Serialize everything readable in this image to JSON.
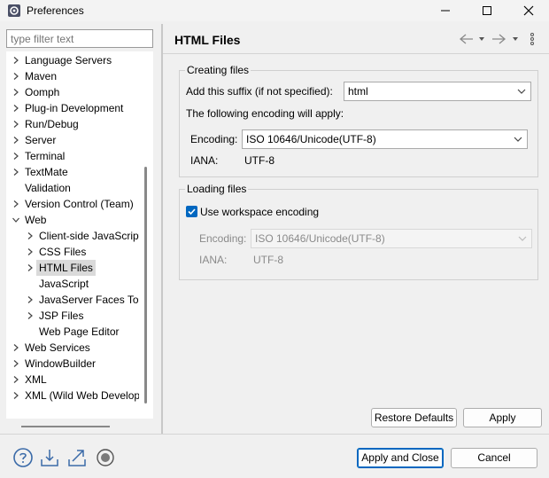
{
  "window": {
    "title": "Preferences"
  },
  "filter": {
    "placeholder": "type filter text"
  },
  "tree": {
    "items": [
      {
        "label": "Language Servers",
        "level": 0,
        "expander": "collapsed"
      },
      {
        "label": "Maven",
        "level": 0,
        "expander": "collapsed"
      },
      {
        "label": "Oomph",
        "level": 0,
        "expander": "collapsed"
      },
      {
        "label": "Plug-in Development",
        "level": 0,
        "expander": "collapsed"
      },
      {
        "label": "Run/Debug",
        "level": 0,
        "expander": "collapsed"
      },
      {
        "label": "Server",
        "level": 0,
        "expander": "collapsed"
      },
      {
        "label": "Terminal",
        "level": 0,
        "expander": "collapsed"
      },
      {
        "label": "TextMate",
        "level": 0,
        "expander": "collapsed"
      },
      {
        "label": "Validation",
        "level": 0,
        "expander": "none"
      },
      {
        "label": "Version Control (Team)",
        "level": 0,
        "expander": "collapsed"
      },
      {
        "label": "Web",
        "level": 0,
        "expander": "expanded"
      },
      {
        "label": "Client-side JavaScript",
        "level": 1,
        "expander": "collapsed"
      },
      {
        "label": "CSS Files",
        "level": 1,
        "expander": "collapsed"
      },
      {
        "label": "HTML Files",
        "level": 1,
        "expander": "collapsed",
        "selected": true
      },
      {
        "label": "JavaScript",
        "level": 1,
        "expander": "none"
      },
      {
        "label": "JavaServer Faces Tools",
        "level": 1,
        "expander": "collapsed"
      },
      {
        "label": "JSP Files",
        "level": 1,
        "expander": "collapsed"
      },
      {
        "label": "Web Page Editor",
        "level": 1,
        "expander": "none"
      },
      {
        "label": "Web Services",
        "level": 0,
        "expander": "collapsed"
      },
      {
        "label": "WindowBuilder",
        "level": 0,
        "expander": "collapsed"
      },
      {
        "label": "XML",
        "level": 0,
        "expander": "collapsed"
      },
      {
        "label": "XML (Wild Web Developer)",
        "level": 0,
        "expander": "collapsed"
      }
    ]
  },
  "page": {
    "title": "HTML Files",
    "creating": {
      "group_title": "Creating files",
      "suffix_label": "Add this suffix (if not specified):",
      "suffix_value": "html",
      "encoding_note": "The following encoding will apply:",
      "encoding_label": "Encoding:",
      "encoding_value": "ISO 10646/Unicode(UTF-8)",
      "iana_label": "IANA:",
      "iana_value": "UTF-8"
    },
    "loading": {
      "group_title": "Loading files",
      "use_workspace_label": "Use workspace encoding",
      "use_workspace_checked": true,
      "encoding_label": "Encoding:",
      "encoding_value": "ISO 10646/Unicode(UTF-8)",
      "iana_label": "IANA:",
      "iana_value": "UTF-8"
    },
    "restore_defaults_label": "Restore Defaults",
    "apply_label": "Apply"
  },
  "footer": {
    "apply_close_label": "Apply and Close",
    "cancel_label": "Cancel"
  },
  "icons": {
    "app": "preferences-gear-icon",
    "minimize": "minimize-icon",
    "maximize": "maximize-icon",
    "close": "close-icon",
    "back": "back-arrow-icon",
    "forward": "forward-arrow-icon",
    "menu": "view-menu-icon",
    "help": "help-icon",
    "import": "import-icon",
    "export": "export-icon",
    "record": "oomph-record-icon"
  },
  "colors": {
    "accent": "#0067c0",
    "selection": "#dadada"
  }
}
